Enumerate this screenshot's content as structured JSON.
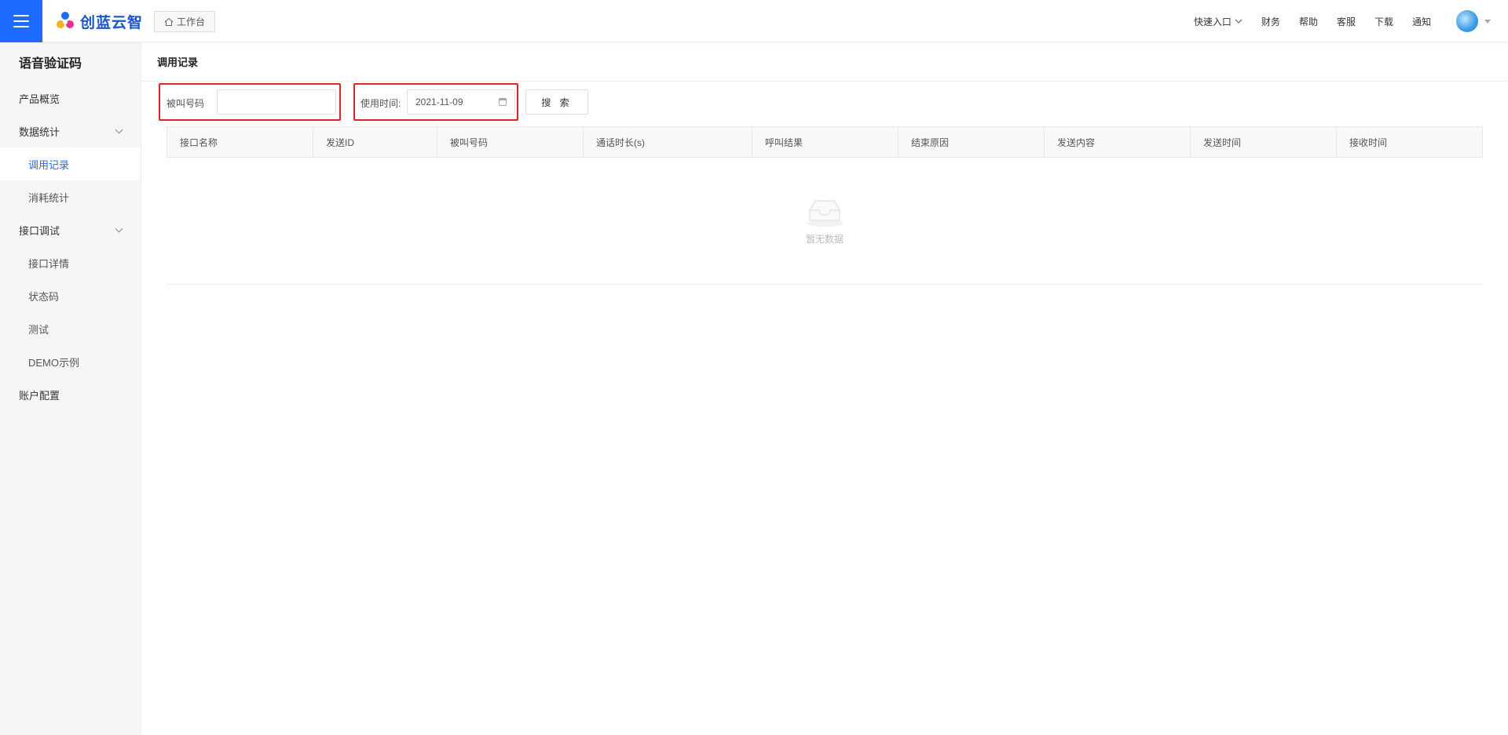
{
  "header": {
    "logo_text": "创蓝云智",
    "workbench_label": "工作台",
    "nav": [
      {
        "label": "快速入口",
        "dropdown": true
      },
      {
        "label": "财务"
      },
      {
        "label": "帮助"
      },
      {
        "label": "客服"
      },
      {
        "label": "下载"
      },
      {
        "label": "通知"
      }
    ],
    "accent_color": "#1f6bff"
  },
  "sidebar": {
    "title": "语音验证码",
    "items": [
      {
        "label": "产品概览",
        "level": 1
      },
      {
        "label": "数据统计",
        "level": 1,
        "expandable": true
      },
      {
        "label": "调用记录",
        "level": 2,
        "active": true
      },
      {
        "label": "消耗统计",
        "level": 2
      },
      {
        "label": "接口调试",
        "level": 1,
        "expandable": true
      },
      {
        "label": "接口详情",
        "level": 2
      },
      {
        "label": "状态码",
        "level": 2
      },
      {
        "label": "测试",
        "level": 2
      },
      {
        "label": "DEMO示例",
        "level": 2
      },
      {
        "label": "账户配置",
        "level": 1
      }
    ]
  },
  "main": {
    "page_title": "调用记录",
    "filters": {
      "called_number_label": "被叫号码",
      "called_number_value": "",
      "use_time_label": "使用时间:",
      "use_time_value": "2021-11-09",
      "search_label": "搜 索"
    },
    "table": {
      "columns": [
        "接口名称",
        "发送ID",
        "被叫号码",
        "通话时长(s)",
        "呼叫结果",
        "结束原因",
        "发送内容",
        "发送时间",
        "接收时间"
      ],
      "rows": [],
      "empty_text": "暂无数据"
    }
  }
}
